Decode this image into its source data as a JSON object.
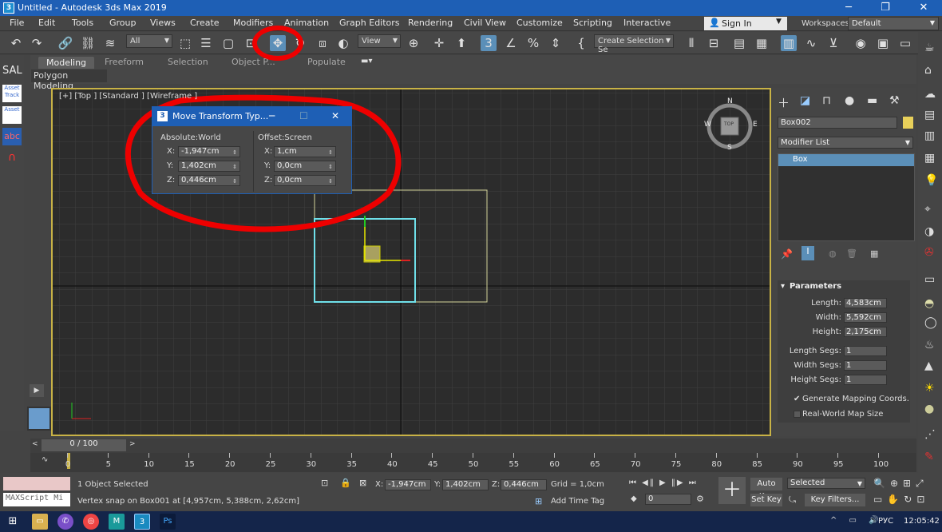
{
  "window": {
    "title": "Untitled - Autodesk 3ds Max 2019",
    "app_icon": "3",
    "minimize": "─",
    "maximize": "❐",
    "close": "✕"
  },
  "menu": [
    "File",
    "Edit",
    "Tools",
    "Group",
    "Views",
    "Create",
    "Modifiers",
    "Animation",
    "Graph Editors",
    "Rendering",
    "Civil View",
    "Customize",
    "Scripting",
    "Interactive"
  ],
  "account": {
    "signin": "Sign In",
    "workspace_label": "Workspaces:",
    "workspace_value": "Default"
  },
  "toolbar": {
    "filter": "All",
    "ref_coord": "View",
    "selection_set": "Create Selection Se"
  },
  "ribbon": {
    "tabs": [
      "Modeling",
      "Freeform",
      "Selection",
      "Object P...",
      "Populate"
    ],
    "sub": "Polygon Modeling"
  },
  "left_icons": [
    "SAL",
    "Asset Track",
    "Asset",
    "abc"
  ],
  "viewport": {
    "label": "[+] [Top ] [Standard ] [Wireframe ]"
  },
  "dialog": {
    "title": "Move Transform Typ...",
    "minimize": "─",
    "maximize": "☐",
    "close": "✕",
    "absolute_label": "Absolute:World",
    "offset_label": "Offset:Screen",
    "abs": [
      {
        "axis": "X:",
        "value": "-1,947cm"
      },
      {
        "axis": "Y:",
        "value": "1,402cm"
      },
      {
        "axis": "Z:",
        "value": "0,446cm"
      }
    ],
    "off": [
      {
        "axis": "X:",
        "value": "1,cm"
      },
      {
        "axis": "Y:",
        "value": "0,0cm"
      },
      {
        "axis": "Z:",
        "value": "0,0cm"
      }
    ]
  },
  "compass": {
    "n": "N",
    "s": "S",
    "e": "E",
    "w": "W",
    "top": "TOP"
  },
  "command_panel": {
    "object_name": "Box002",
    "modifier_list": "Modifier List",
    "stack_item": "Box",
    "rollout_title": "Parameters",
    "params": [
      {
        "label": "Length:",
        "value": "4,583cm"
      },
      {
        "label": "Width:",
        "value": "5,592cm"
      },
      {
        "label": "Height:",
        "value": "2,175cm"
      }
    ],
    "segs": [
      {
        "label": "Length Segs:",
        "value": "1"
      },
      {
        "label": "Width Segs:",
        "value": "1"
      },
      {
        "label": "Height Segs:",
        "value": "1"
      }
    ],
    "gen_mapping": "Generate Mapping Coords.",
    "real_world": "Real-World Map Size"
  },
  "timeline": {
    "frame": "0 / 100",
    "ticks": [
      "0",
      "5",
      "10",
      "15",
      "20",
      "25",
      "30",
      "35",
      "40",
      "45",
      "50",
      "55",
      "60",
      "65",
      "70",
      "75",
      "80",
      "85",
      "90",
      "95",
      "100"
    ]
  },
  "status": {
    "maxscript": "MAXScript Mi",
    "selected": "1 Object Selected",
    "prompt": "Vertex snap on Box001 at [4,957cm, 5,388cm, 2,62cm]",
    "x_label": "X:",
    "x": "-1,947cm",
    "y_label": "Y:",
    "y": "1,402cm",
    "z_label": "Z:",
    "z": "0,446cm",
    "grid": "Grid = 1,0cm",
    "add_time_tag": "Add Time Tag",
    "auto_key": "Auto Key",
    "set_key": "Set Key",
    "key_selected": "Selected",
    "key_filters": "Key Filters...",
    "frame_value": "0"
  },
  "taskbar": {
    "lang": "РУС",
    "time": "12:05:42"
  }
}
